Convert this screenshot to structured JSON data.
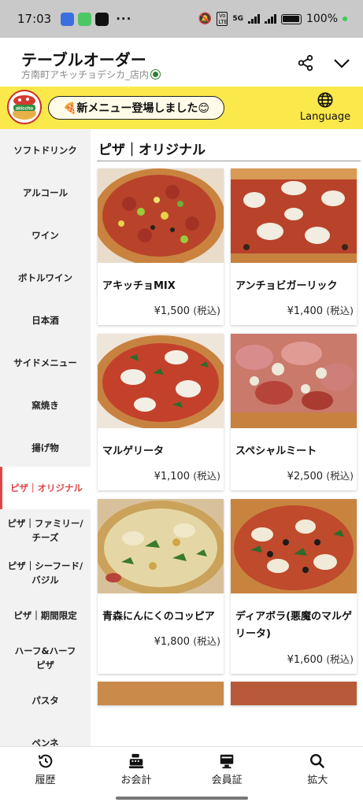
{
  "status_bar": {
    "time": "17:03",
    "dots": "···",
    "battery_text": "100%",
    "network_5g": "5G",
    "lte_label": "Vo LTE"
  },
  "header": {
    "title": "テーブルオーダー",
    "subtitle": "方南町アキッチョデシカ_店内"
  },
  "banner": {
    "news_text": "🍕新メニュー登場しました😊",
    "language_label": "Language",
    "logo_text": "akiccho"
  },
  "sidebar": {
    "items": [
      {
        "label": "ソフトドリンク"
      },
      {
        "label": "アルコール"
      },
      {
        "label": "ワイン"
      },
      {
        "label": "ボトルワイン"
      },
      {
        "label": "日本酒"
      },
      {
        "label": "サイドメニュー"
      },
      {
        "label": "窯焼き"
      },
      {
        "label": "揚げ物"
      },
      {
        "label": "ピザ｜オリジナル"
      },
      {
        "label": "ピザ｜ファミリー/チーズ"
      },
      {
        "label": "ピザ｜シーフード/バジル"
      },
      {
        "label": "ピザ｜期間限定"
      },
      {
        "label": "ハーフ&ハーフピザ"
      },
      {
        "label": "パスタ"
      },
      {
        "label": "ペンネ"
      }
    ],
    "active_index": 8
  },
  "section": {
    "title": "ピザ｜オリジナル"
  },
  "menu_items": [
    {
      "name": "アキッチョMIX",
      "price": "¥1,500",
      "tax": "(税込)"
    },
    {
      "name": "アンチョビガーリック",
      "price": "¥1,400",
      "tax": "(税込)"
    },
    {
      "name": "マルゲリータ",
      "price": "¥1,100",
      "tax": "(税込)"
    },
    {
      "name": "スペシャルミート",
      "price": "¥2,500",
      "tax": "(税込)"
    },
    {
      "name": "青森にんにくのコッピア",
      "price": "¥1,800",
      "tax": "(税込)"
    },
    {
      "name": "ディアボラ(悪魔のマルゲリータ)",
      "price": "¥1,600",
      "tax": "(税込)"
    }
  ],
  "bottom_nav": [
    {
      "label": "履歴",
      "icon": "history-icon"
    },
    {
      "label": "お会計",
      "icon": "cash-register-icon"
    },
    {
      "label": "会員証",
      "icon": "member-card-icon"
    },
    {
      "label": "拡大",
      "icon": "zoom-icon"
    }
  ],
  "colors": {
    "accent_red": "#e04545",
    "banner_yellow": "#fbe84a",
    "sidebar_bg": "#f2f2f2"
  }
}
